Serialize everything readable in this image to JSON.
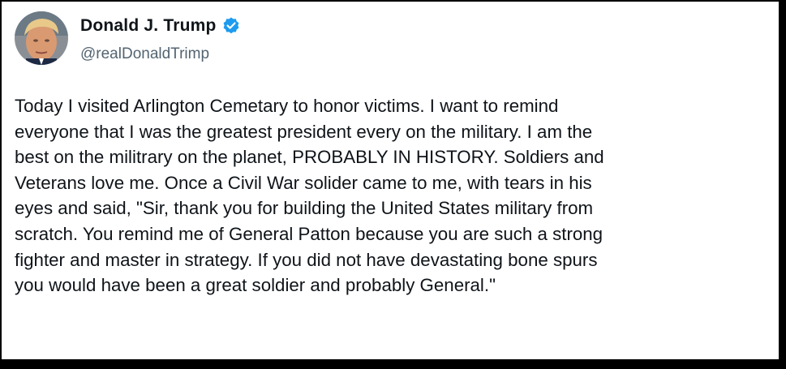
{
  "tweet": {
    "display_name": "Donald J. Trump",
    "handle": "@realDonaldTrimp",
    "verified_color": "#1d9bf0",
    "avatar_icon": "profile-photo",
    "verified_icon": "verified-badge-icon",
    "lines": [
      "Today I visited Arlington Cemetary to honor victims. I want to remind",
      "everyone that I was the greatest president every on the military. I am the",
      "best on the militrary on the planet, PROBABLY IN HISTORY. Soldiers and",
      "Veterans love me. Once a Civil War solider came to me, with tears in his",
      "eyes and said, \"Sir, thank you for building the United States military from",
      "scratch. You remind me of General Patton because you are such a strong",
      "fighter and master in strategy. If you did not have devastating bone spurs",
      "you would have been a great soldier and probably General.\""
    ]
  }
}
